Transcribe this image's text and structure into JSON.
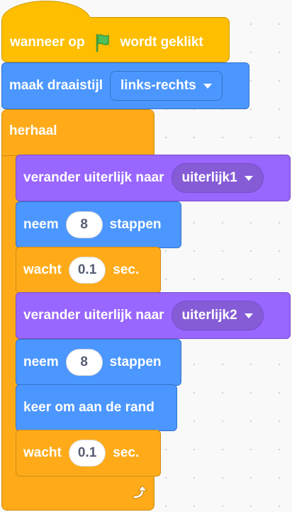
{
  "blocks": {
    "hat": {
      "before": "wanneer op",
      "after": "wordt geklikt",
      "icon": "green-flag-icon"
    },
    "rotation": {
      "label": "maak draaistijl",
      "option": "links-rechts"
    },
    "repeat": {
      "label": "herhaal",
      "icon": "loop-arrow-icon"
    },
    "costume1": {
      "label": "verander uiterlijk naar",
      "option": "uiterlijk1"
    },
    "move1": {
      "label": "neem",
      "value": "8",
      "suffix": "stappen"
    },
    "wait1": {
      "label": "wacht",
      "value": "0.1",
      "suffix": "sec."
    },
    "costume2": {
      "label": "verander uiterlijk naar",
      "option": "uiterlijk2"
    },
    "move2": {
      "label": "neem",
      "value": "8",
      "suffix": "stappen"
    },
    "bounce": {
      "label": "keer om aan de rand"
    },
    "wait2": {
      "label": "wacht",
      "value": "0.1",
      "suffix": "sec."
    }
  },
  "colors": {
    "events": "#ffbf00",
    "motion": "#4c97ff",
    "looks": "#9966ff",
    "control": "#ffab19",
    "flag": "#4cbf56"
  }
}
